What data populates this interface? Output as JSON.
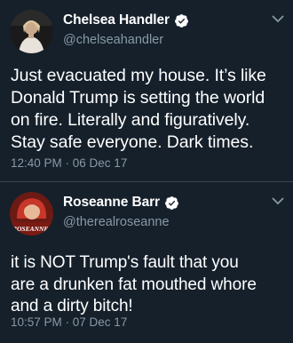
{
  "colors": {
    "background": "#15202b",
    "text": "#ffffff",
    "secondary_text": "#8899a6",
    "divider": "#38444d",
    "verified": "#ffffff"
  },
  "tweets": [
    {
      "display_name": "Chelsea Handler",
      "handle": "@chelseahandler",
      "verified": true,
      "avatar_icon": "avatar-photo",
      "text_lines": [
        "Just evacuated my house. It’s like",
        "Donald Trump is setting the world",
        "on fire. Literally and figuratively.",
        "Stay safe everyone. Dark times."
      ],
      "timestamp": "12:40 PM · 06 Dec 17"
    },
    {
      "display_name": "Roseanne Barr",
      "handle": "@therealroseanne",
      "verified": true,
      "avatar_icon": "avatar-photo",
      "avatar_logo_text": "ROSEANNE",
      "text_lines": [
        "it is NOT Trump's fault that you",
        "are a drunken fat mouthed whore",
        "and a dirty bitch!"
      ],
      "timestamp": "10:57 PM · 07 Dec 17"
    }
  ]
}
